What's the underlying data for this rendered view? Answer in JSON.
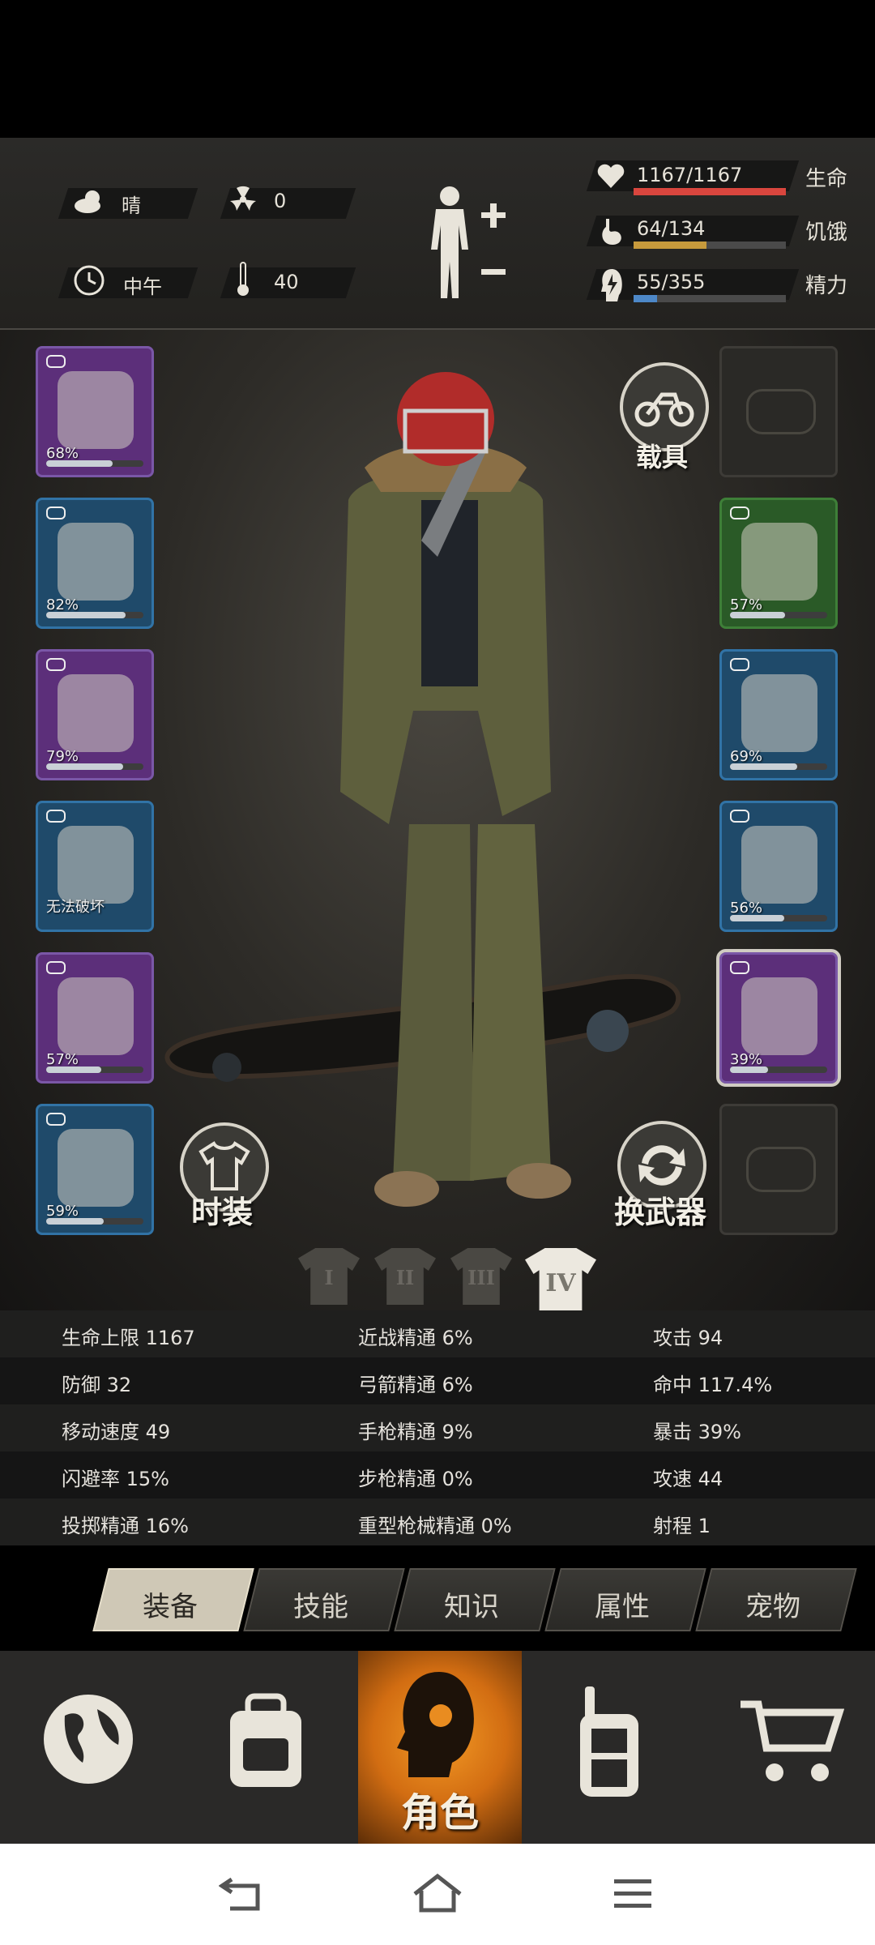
{
  "status": {
    "weather": "晴",
    "radiation": "0",
    "time_of_day": "中午",
    "temperature": "40",
    "vitals": [
      {
        "label": "生命",
        "value": "1167/1167",
        "fraction": 1.0,
        "color": "#d9463e"
      },
      {
        "label": "饥饿",
        "value": "64/134",
        "fraction": 0.478,
        "color": "#c79a3c"
      },
      {
        "label": "精力",
        "value": "55/355",
        "fraction": 0.155,
        "color": "#4d88c8"
      }
    ]
  },
  "equipment_left": [
    {
      "name": "helmet",
      "pct": "68%",
      "fraction": 0.68,
      "rarity": "purple"
    },
    {
      "name": "undershirt",
      "pct": "82%",
      "fraction": 0.82,
      "rarity": "blue"
    },
    {
      "name": "jacket",
      "pct": "79%",
      "fraction": 0.79,
      "rarity": "purple"
    },
    {
      "name": "backpack",
      "pct": "无法破坏",
      "fraction": 0,
      "rarity": "blue"
    },
    {
      "name": "pants",
      "pct": "57%",
      "fraction": 0.57,
      "rarity": "purple"
    },
    {
      "name": "boots",
      "pct": "59%",
      "fraction": 0.59,
      "rarity": "blue"
    }
  ],
  "equipment_right": [
    {
      "name": "glasses",
      "pct": "",
      "fraction": 0,
      "rarity": "empty"
    },
    {
      "name": "mask",
      "pct": "57%",
      "fraction": 0.57,
      "rarity": "green"
    },
    {
      "name": "vest",
      "pct": "69%",
      "fraction": 0.69,
      "rarity": "blue"
    },
    {
      "name": "shield",
      "pct": "56%",
      "fraction": 0.56,
      "rarity": "blue"
    },
    {
      "name": "machete",
      "pct": "39%",
      "fraction": 0.39,
      "rarity": "purple"
    },
    {
      "name": "offhand",
      "pct": "",
      "fraction": 0,
      "rarity": "empty"
    }
  ],
  "buttons": {
    "vehicle": "载具",
    "fashion": "时装",
    "swap_weapon": "换武器"
  },
  "outfit_sets": [
    "I",
    "II",
    "III",
    "IV"
  ],
  "active_outfit": 3,
  "stats": [
    [
      "生命上限 1167",
      "近战精通 6%",
      "攻击 94"
    ],
    [
      "防御 32",
      "弓箭精通 6%",
      "命中 117.4%"
    ],
    [
      "移动速度 49",
      "手枪精通 9%",
      "暴击 39%"
    ],
    [
      "闪避率 15%",
      "步枪精通 0%",
      "攻速 44"
    ],
    [
      "投掷精通 16%",
      "重型枪械精通 0%",
      "射程 1"
    ]
  ],
  "tabs": [
    "装备",
    "技能",
    "知识",
    "属性",
    "宠物"
  ],
  "nav": {
    "role_label": "角色"
  }
}
